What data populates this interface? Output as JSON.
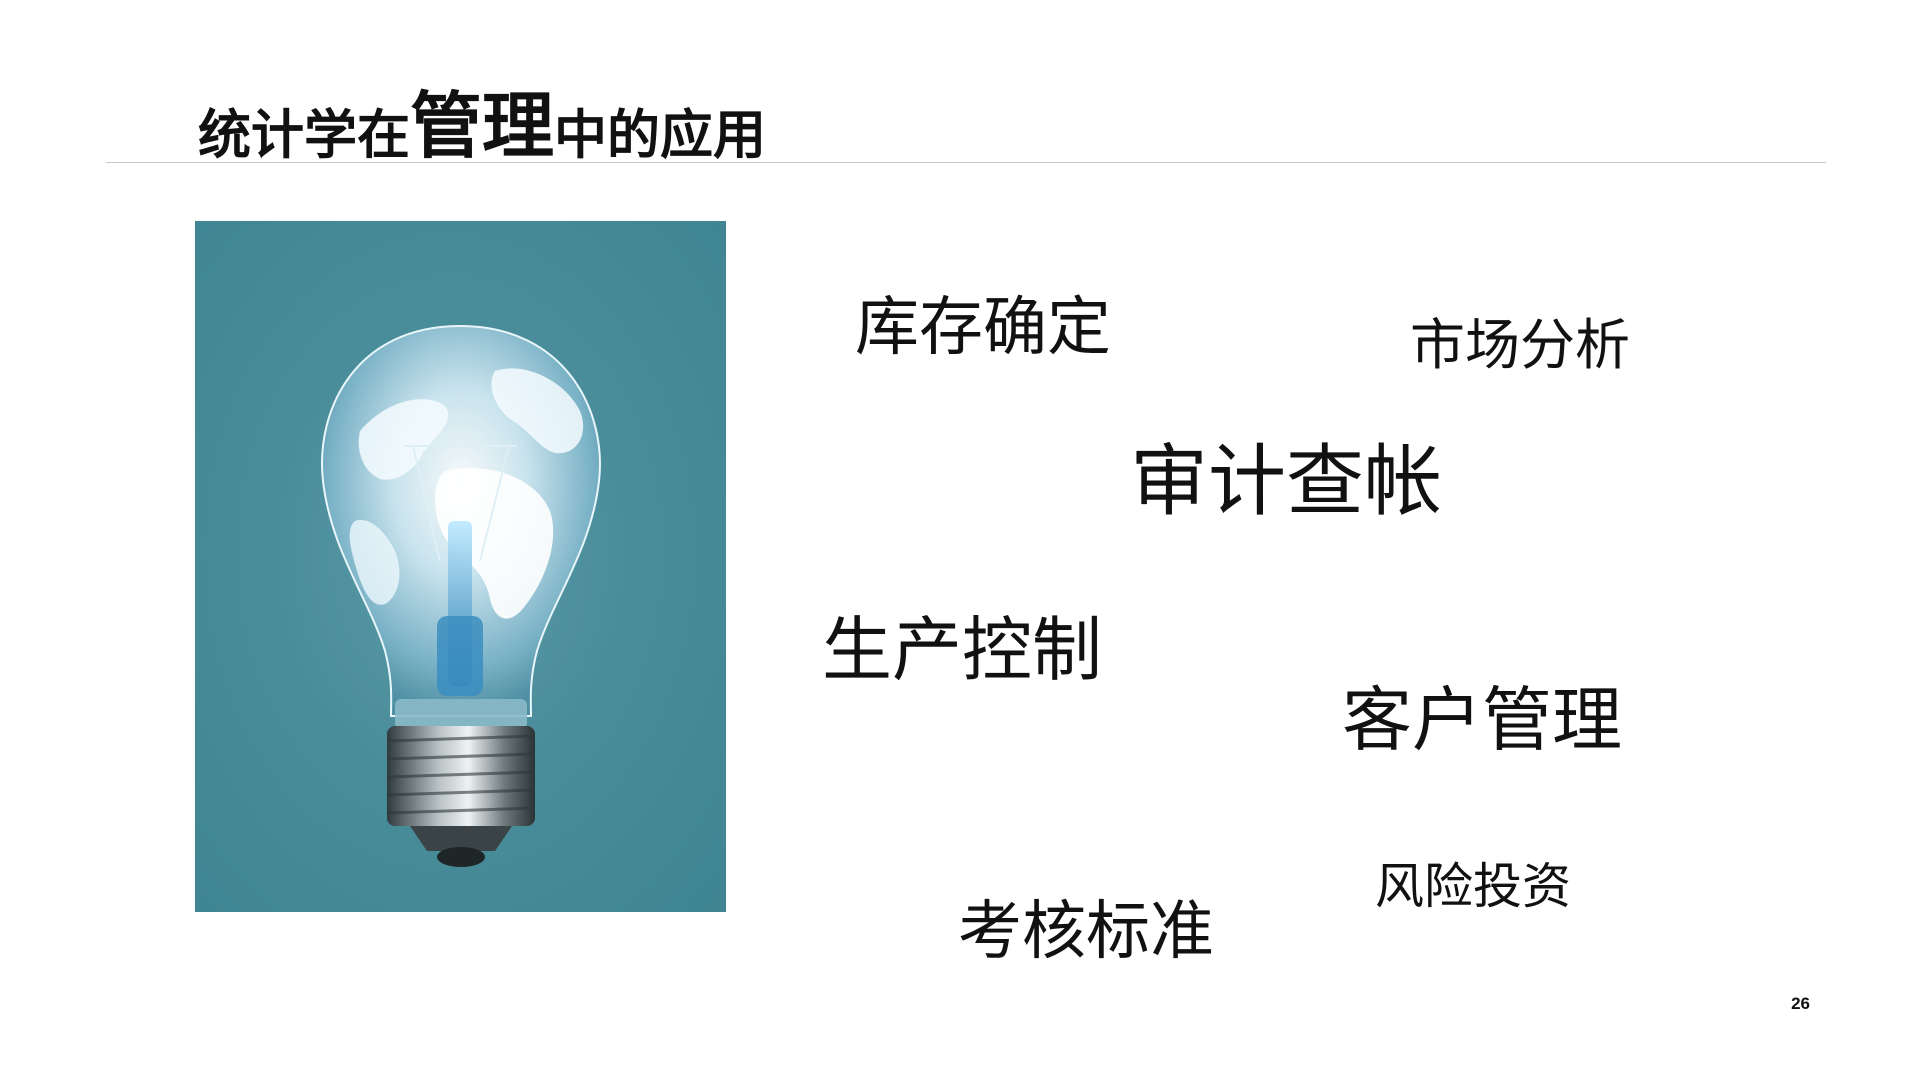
{
  "slide": {
    "title_part1": "统计学在",
    "title_part2": "管理",
    "title_part3": "中的应用",
    "page_number": "26"
  },
  "keywords": [
    "库存确定",
    "市场分析",
    "审计查帐",
    "生产控制",
    "客户管理",
    "风险投资",
    "考核标准"
  ],
  "image": {
    "subject": "lightbulb-globe",
    "background_color": "#468b98"
  }
}
